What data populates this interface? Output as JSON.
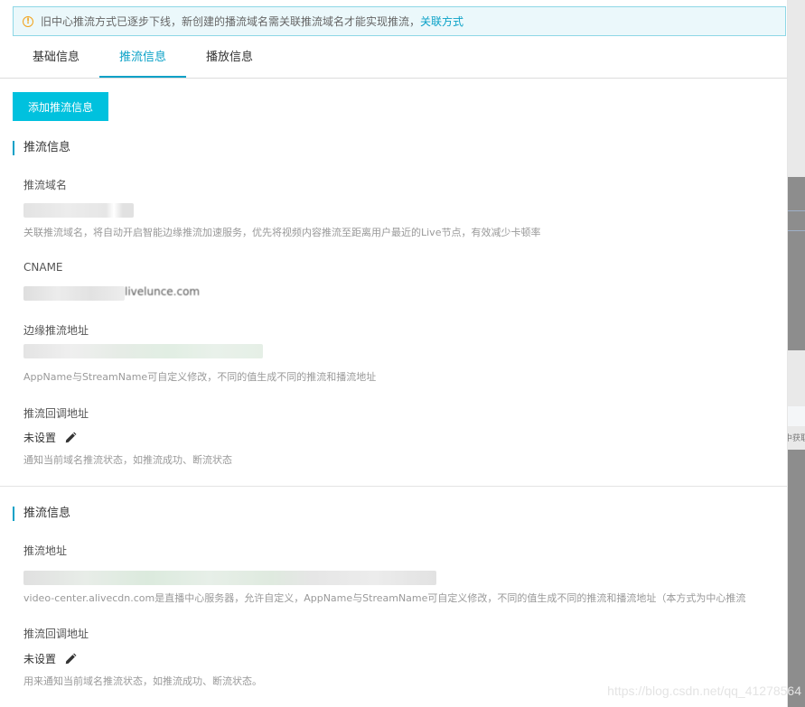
{
  "notice": {
    "text": "旧中心推流方式已逐步下线，新创建的播流域名需关联推流域名才能实现推流，",
    "link": "关联方式"
  },
  "tabs": [
    {
      "label": "基础信息"
    },
    {
      "label": "推流信息"
    },
    {
      "label": "播放信息"
    }
  ],
  "add_button": "添加推流信息",
  "section1": {
    "title": "推流信息",
    "push_domain_label": "推流域名",
    "push_domain_help": "关联推流域名，将自动开启智能边缘推流加速服务，优先将视频内容推流至距离用户最近的Live节点，有效减少卡顿率",
    "cname_label": "CNAME",
    "cname_value_visible": "livelunce.com",
    "edge_label": "边缘推流地址",
    "edge_help": "AppName与StreamName可自定义修改，不同的值生成不同的推流和播流地址",
    "callback_label": "推流回调地址",
    "callback_value": "未设置",
    "callback_help": "通知当前域名推流状态，如推流成功、断流状态"
  },
  "section2": {
    "title": "推流信息",
    "push_url_label": "推流地址",
    "push_url_help": "video-center.alivecdn.com是直播中心服务器，允许自定义，AppName与StreamName可自定义修改，不同的值生成不同的推流和播流地址（本方式为中心推流",
    "callback_label": "推流回调地址",
    "callback_value": "未设置",
    "callback_help": "用来通知当前域名推流状态，如推流成功、断流状态。"
  },
  "backdrop_text": "中获取",
  "watermark": "https://blog.csdn.net/qq_41278564",
  "colors": {
    "accent": "#0aa1c7",
    "button": "#00c1de",
    "notice_bg": "#ebf8fb",
    "notice_border": "#8ed7e6",
    "warning": "#f2a21a"
  }
}
